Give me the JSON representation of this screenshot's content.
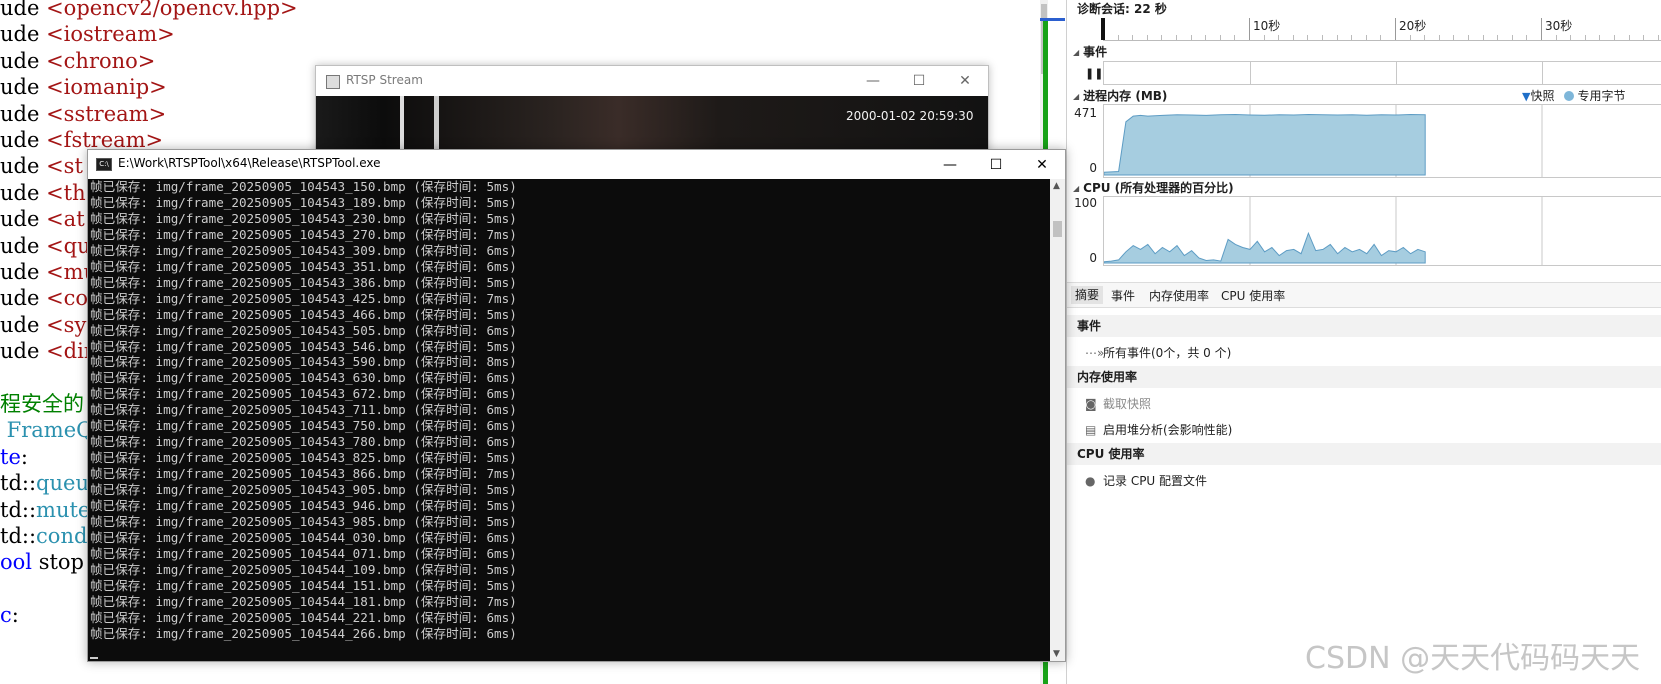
{
  "editor": {
    "lines": [
      [
        {
          "t": "ude ",
          "c": "inc"
        },
        {
          "t": "<opencv2/opencv.hpp>",
          "c": "hdr"
        }
      ],
      [
        {
          "t": "ude ",
          "c": "inc"
        },
        {
          "t": "<iostream>",
          "c": "hdr"
        }
      ],
      [
        {
          "t": "ude ",
          "c": "inc"
        },
        {
          "t": "<chrono>",
          "c": "hdr"
        }
      ],
      [
        {
          "t": "ude ",
          "c": "inc"
        },
        {
          "t": "<iomanip>",
          "c": "hdr"
        }
      ],
      [
        {
          "t": "ude ",
          "c": "inc"
        },
        {
          "t": "<sstream>",
          "c": "hdr"
        }
      ],
      [
        {
          "t": "ude ",
          "c": "inc"
        },
        {
          "t": "<fstream>",
          "c": "hdr"
        }
      ],
      [
        {
          "t": "ude ",
          "c": "inc"
        },
        {
          "t": "<st",
          "c": "hdr"
        }
      ],
      [
        {
          "t": "ude ",
          "c": "inc"
        },
        {
          "t": "<th",
          "c": "hdr"
        }
      ],
      [
        {
          "t": "ude ",
          "c": "inc"
        },
        {
          "t": "<at",
          "c": "hdr"
        }
      ],
      [
        {
          "t": "ude ",
          "c": "inc"
        },
        {
          "t": "<que",
          "c": "hdr"
        }
      ],
      [
        {
          "t": "ude ",
          "c": "inc"
        },
        {
          "t": "<mut",
          "c": "hdr"
        }
      ],
      [
        {
          "t": "ude ",
          "c": "inc"
        },
        {
          "t": "<con",
          "c": "hdr"
        }
      ],
      [
        {
          "t": "ude ",
          "c": "inc"
        },
        {
          "t": "<sys",
          "c": "hdr"
        }
      ],
      [
        {
          "t": "ude ",
          "c": "inc"
        },
        {
          "t": "<dir",
          "c": "hdr"
        }
      ],
      [],
      [
        {
          "t": "程安全的",
          "c": "cmt"
        }
      ],
      [
        {
          "t": " FrameQu",
          "c": "type"
        }
      ],
      [
        {
          "t": "te",
          "c": "kw"
        },
        {
          "t": ":",
          "c": "plain"
        }
      ],
      [
        {
          "t": "td::",
          "c": "plain"
        },
        {
          "t": "queu",
          "c": "type"
        }
      ],
      [
        {
          "t": "td::",
          "c": "plain"
        },
        {
          "t": "mute",
          "c": "type"
        }
      ],
      [
        {
          "t": "td::",
          "c": "plain"
        },
        {
          "t": "cond",
          "c": "type"
        }
      ],
      [
        {
          "t": "ool",
          "c": "kw"
        },
        {
          "t": " stop",
          "c": "plain"
        }
      ],
      [],
      [
        {
          "t": "c",
          "c": "kw"
        },
        {
          "t": ":",
          "c": "plain"
        }
      ]
    ]
  },
  "diagnostics": {
    "session": "诊断会话: 22 秒",
    "ruler_ticks": [
      "10秒",
      "20秒",
      "30秒"
    ],
    "sections": {
      "events": "事件",
      "memory": "进程内存 (MB)",
      "cpu": "CPU (所有处理器的百分比)"
    },
    "memory_axis": {
      "max": "471",
      "min": "0"
    },
    "cpu_axis": {
      "max": "100",
      "min": "0"
    },
    "legend": {
      "snapshot": "快照",
      "private_bytes": "专用字节"
    },
    "tabs": [
      "摘要",
      "事件",
      "内存使用率",
      "CPU 使用率"
    ],
    "groups": {
      "events": "事件",
      "memory": "内存使用率",
      "cpu": "CPU 使用率"
    },
    "items": {
      "all_events": "所有事件(0个，共 0 个)",
      "take_snapshot": "截取快照",
      "heap_analysis": "启用堆分析(会影响性能)",
      "record_cpu": "记录 CPU 配置文件"
    },
    "colors": {
      "chart_fill": "#a6cde0",
      "chart_line": "#5d9cc4",
      "accent": "#1f6fc8"
    }
  },
  "chart_data": [
    {
      "type": "area",
      "title": "进程内存 (MB)",
      "xlabel": "",
      "ylabel": "",
      "ylim": [
        0,
        471
      ],
      "x_ticks": [
        "10秒",
        "20秒",
        "30秒"
      ],
      "x": [
        0,
        1,
        1.5,
        2,
        2.5,
        3,
        4,
        5,
        6,
        7,
        8,
        9,
        10,
        11,
        12,
        13,
        14,
        15,
        16,
        17,
        18,
        19,
        20,
        21,
        22
      ],
      "values": [
        20,
        25,
        380,
        420,
        425,
        420,
        425,
        430,
        428,
        425,
        430,
        432,
        428,
        426,
        430,
        428,
        432,
        430,
        428,
        430,
        426,
        430,
        428,
        432,
        430
      ]
    },
    {
      "type": "area",
      "title": "CPU (所有处理器的百分比)",
      "xlabel": "",
      "ylabel": "",
      "ylim": [
        0,
        100
      ],
      "x_ticks": [
        "10秒",
        "20秒",
        "30秒"
      ],
      "x": [
        0,
        0.5,
        1,
        1.5,
        2,
        2.5,
        3,
        3.5,
        4,
        4.5,
        5,
        5.5,
        6,
        6.5,
        7,
        7.5,
        8,
        8.5,
        9,
        9.5,
        10,
        10.5,
        11,
        11.5,
        12,
        12.5,
        13,
        13.5,
        14,
        14.5,
        15,
        15.5,
        16,
        16.5,
        17,
        17.5,
        18,
        18.5,
        19,
        19.5,
        20,
        20.5,
        21,
        21.5,
        22
      ],
      "values": [
        2,
        3,
        5,
        18,
        28,
        22,
        30,
        15,
        25,
        18,
        28,
        12,
        20,
        8,
        4,
        5,
        3,
        38,
        30,
        25,
        22,
        35,
        18,
        25,
        12,
        20,
        22,
        15,
        48,
        20,
        22,
        30,
        15,
        25,
        18,
        22,
        15,
        30,
        12,
        20,
        18,
        25,
        15,
        22,
        18
      ]
    }
  ],
  "rtsp_window": {
    "title": "RTSP Stream",
    "timestamp": "2000-01-02 20:59:30"
  },
  "console_window": {
    "title": "E:\\Work\\RTSPTool\\x64\\Release\\RTSPTool.exe",
    "lines": [
      "帧已保存: img/frame_20250905_104543_150.bmp (保存时间: 5ms)",
      "帧已保存: img/frame_20250905_104543_189.bmp (保存时间: 5ms)",
      "帧已保存: img/frame_20250905_104543_230.bmp (保存时间: 5ms)",
      "帧已保存: img/frame_20250905_104543_270.bmp (保存时间: 7ms)",
      "帧已保存: img/frame_20250905_104543_309.bmp (保存时间: 6ms)",
      "帧已保存: img/frame_20250905_104543_351.bmp (保存时间: 6ms)",
      "帧已保存: img/frame_20250905_104543_386.bmp (保存时间: 5ms)",
      "帧已保存: img/frame_20250905_104543_425.bmp (保存时间: 7ms)",
      "帧已保存: img/frame_20250905_104543_466.bmp (保存时间: 5ms)",
      "帧已保存: img/frame_20250905_104543_505.bmp (保存时间: 6ms)",
      "帧已保存: img/frame_20250905_104543_546.bmp (保存时间: 5ms)",
      "帧已保存: img/frame_20250905_104543_590.bmp (保存时间: 8ms)",
      "帧已保存: img/frame_20250905_104543_630.bmp (保存时间: 6ms)",
      "帧已保存: img/frame_20250905_104543_672.bmp (保存时间: 6ms)",
      "帧已保存: img/frame_20250905_104543_711.bmp (保存时间: 6ms)",
      "帧已保存: img/frame_20250905_104543_750.bmp (保存时间: 6ms)",
      "帧已保存: img/frame_20250905_104543_780.bmp (保存时间: 6ms)",
      "帧已保存: img/frame_20250905_104543_825.bmp (保存时间: 5ms)",
      "帧已保存: img/frame_20250905_104543_866.bmp (保存时间: 7ms)",
      "帧已保存: img/frame_20250905_104543_905.bmp (保存时间: 5ms)",
      "帧已保存: img/frame_20250905_104543_946.bmp (保存时间: 5ms)",
      "帧已保存: img/frame_20250905_104543_985.bmp (保存时间: 5ms)",
      "帧已保存: img/frame_20250905_104544_030.bmp (保存时间: 6ms)",
      "帧已保存: img/frame_20250905_104544_071.bmp (保存时间: 6ms)",
      "帧已保存: img/frame_20250905_104544_109.bmp (保存时间: 5ms)",
      "帧已保存: img/frame_20250905_104544_151.bmp (保存时间: 5ms)",
      "帧已保存: img/frame_20250905_104544_181.bmp (保存时间: 7ms)",
      "帧已保存: img/frame_20250905_104544_221.bmp (保存时间: 6ms)",
      "帧已保存: img/frame_20250905_104544_266.bmp (保存时间: 6ms)"
    ]
  },
  "window_controls": {
    "minimize": "—",
    "maximize": "☐",
    "close": "✕"
  },
  "watermark": "CSDN @天天代码码天天"
}
